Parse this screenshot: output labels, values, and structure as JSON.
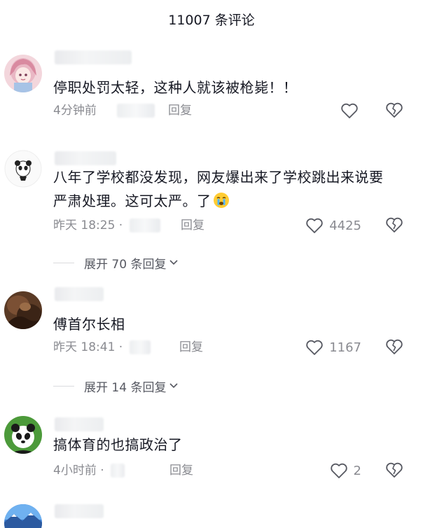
{
  "header": {
    "title": "11007 条评论"
  },
  "comments": [
    {
      "text": "停职处罚太轻，这种人就该被枪毙！！",
      "time": "4分钟前",
      "reply_label": "回复",
      "likes": "",
      "avatar_icon": "anime-girl-avatar-icon"
    },
    {
      "text": "八年了学校都没发现，网友爆出来了学校跳出来说要严肃处理。这可太严。了",
      "emoji": "crying-emoji-icon",
      "time": "昨天 18:25 ·",
      "reply_label": "回复",
      "likes": "4425",
      "expand_label": "展开 70 条回复",
      "avatar_icon": "panda-avatar-icon"
    },
    {
      "text": "傅首尔长相",
      "time": "昨天 18:41 ·",
      "reply_label": "回复",
      "likes": "1167",
      "expand_label": "展开 14 条回复",
      "avatar_icon": "brown-photo-avatar-icon"
    },
    {
      "text": "搞体育的也搞政治了",
      "time": "4小时前 ·",
      "reply_label": "回复",
      "likes": "2",
      "avatar_icon": "panda-green-avatar-icon"
    },
    {
      "avatar_icon": "landscape-avatar-icon"
    }
  ],
  "colors": {
    "text": "#161823",
    "secondary": "#8a8b91",
    "divider": "#dadbde"
  }
}
